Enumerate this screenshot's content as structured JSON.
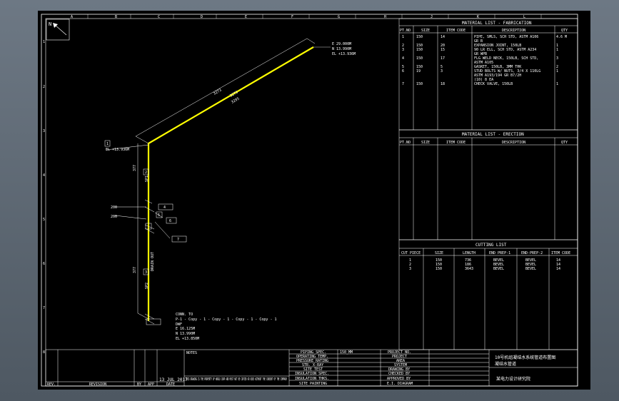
{
  "grid_top": [
    "A",
    "B",
    "C",
    "D",
    "E",
    "F",
    "G",
    "H",
    "J",
    "K",
    "L"
  ],
  "grid_left": [
    "1",
    "2",
    "3",
    "4",
    "5",
    "6",
    "7",
    "8"
  ],
  "north_label": "N",
  "coords": {
    "top_lines": [
      "E 29.000M",
      "N 13.990M",
      "EL +13.936M"
    ],
    "bottom_lines": [
      "E 16.125M",
      "N 13.990M",
      "EL +13.850M"
    ],
    "left_el": "EL +13.936M"
  },
  "dims": {
    "diag1": "3273",
    "diag2": "3273",
    "diag3": "3295",
    "vert_upper": "377",
    "vert_lower": "377"
  },
  "labels": {
    "s1": "200",
    "s2": "200",
    "pipe_id": "DRAIN OUT",
    "spool_top": "SP1",
    "spool_bot": "SP2"
  },
  "tags": {
    "t1": "1",
    "t2": "2",
    "t3": "3",
    "t4": "4",
    "t5": "5",
    "t6": "6",
    "t7": "7"
  },
  "continuation": {
    "line1": "CONN. TO",
    "line2": "P-1 - Copy - 1 - Copy - 1 - Copy - 1 - Copy - 1",
    "line3": "DWF"
  },
  "material_fabrication": {
    "title": "MATERIAL LIST - FABRICATION",
    "headers": [
      "PT.NO",
      "SIZE",
      "ITEM CODE",
      "DESCRIPTION",
      "QTY"
    ],
    "rows": [
      {
        "no": "1",
        "size": "150",
        "code": "14",
        "desc": [
          "PIPE, SMLS, SCH STD, ASTM A106",
          "GR B"
        ],
        "qty": "4.6 M"
      },
      {
        "no": "2",
        "size": "150",
        "code": "20",
        "desc": [
          "EXPANSION JOINT, 150LB"
        ],
        "qty": "1"
      },
      {
        "no": "3",
        "size": "150",
        "code": "15",
        "desc": [
          "90 LR ELL, SCH STD, ASTM A234",
          "GR WPB"
        ],
        "qty": "1"
      },
      {
        "no": "4",
        "size": "150",
        "code": "17",
        "desc": [
          "FLG WELD NECK, 150LB, SCH STD,",
          "ASTM A105"
        ],
        "qty": "3"
      },
      {
        "no": "5",
        "size": "150",
        "code": "5",
        "desc": [
          "GASKET, 150LB, 3MM THK"
        ],
        "qty": "2"
      },
      {
        "no": "6",
        "size": "19",
        "code": "3",
        "desc": [
          "STUD BOLTS W/ NUTS, 3/4 X 110LG",
          "ASTM A193/194 GR B7/2H",
          "(10) 8 EA"
        ],
        "qty": "1"
      },
      {
        "no": "7",
        "size": "150",
        "code": "18",
        "desc": [
          "CHECK VALVE, 150LB"
        ],
        "qty": "1"
      }
    ]
  },
  "material_erection": {
    "title": "MATERIAL LIST - ERECTION",
    "headers": [
      "PT.NO",
      "SIZE",
      "ITEM CODE",
      "DESCRIPTION",
      "QTY"
    ]
  },
  "cutting": {
    "title": "CUTTING LIST",
    "headers": [
      "CUT PIECE",
      "SIZE",
      "LENGTH",
      "END PREP-1",
      "END-PREP-2",
      "ITEM CODE"
    ],
    "rows": [
      {
        "piece": "1",
        "size": "150",
        "length": "736",
        "e1": "BEVEL",
        "e2": "BEVEL",
        "code": "14"
      },
      {
        "piece": "2",
        "size": "150",
        "length": "186",
        "e1": "BEVEL",
        "e2": "BEVEL",
        "code": "14"
      },
      {
        "piece": "3",
        "size": "150",
        "length": "3643",
        "e1": "BEVEL",
        "e2": "BEVEL",
        "code": "14"
      }
    ]
  },
  "title_block": {
    "notes_label": "NOTES",
    "date": "13 JUL 2017",
    "rev_headers": [
      "REV.",
      "REVISION",
      "BY",
      "APP",
      "DATE"
    ],
    "disclaimer": "THIS DRAWING IS THE PROPERTY OF WORLD CORP AND MUST NOT BE COPIED OR USED WITHOUT THE CONSENT OF THE COMPANY",
    "spec_labels": [
      "PIPING SPEC.",
      "OPERATING TEMP.",
      "PRESSURE RATING",
      "STR. X-RAY",
      "SITE TEST",
      "INSULATION SPEC.",
      "INSULATION THKS.",
      "SITE PAINTING"
    ],
    "spec_value": "150_MM",
    "proj_labels": [
      "PROJECT NO.",
      "PROJECT",
      "AREA",
      "SYSTEM",
      "DRAWING BY",
      "CHECKED BY",
      "APPROVED BY",
      "E.I. DIAGRAM"
    ],
    "company_lines": [
      "10号机组凝结水系统管道布置图",
      "凝结水管道"
    ],
    "company_bottom": "某电力设计研究院"
  }
}
